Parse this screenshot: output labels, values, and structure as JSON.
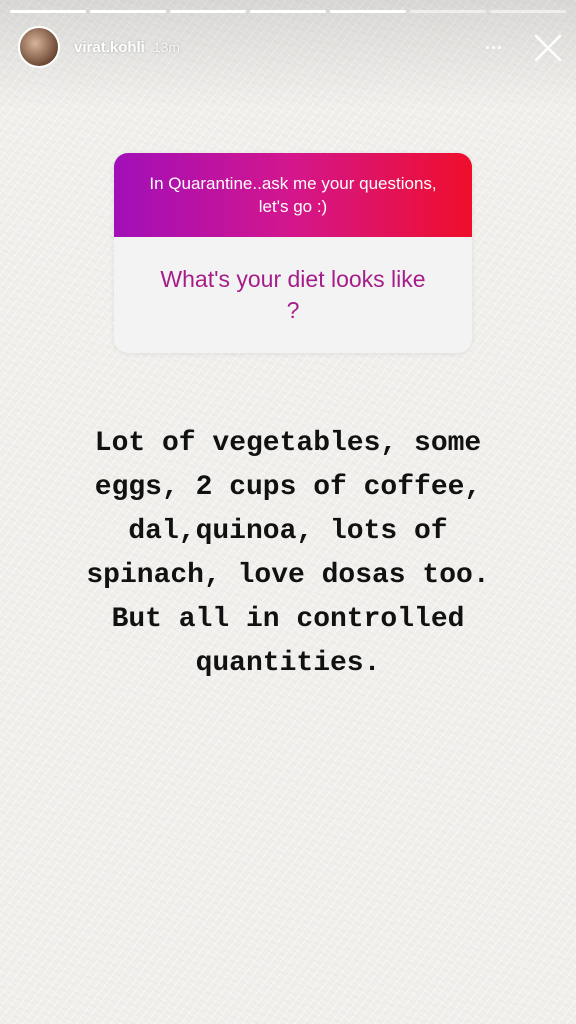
{
  "story": {
    "progress_segments": 7,
    "active_segments": 5,
    "username": "virat.kohli",
    "time_ago": "13m",
    "avatar_icon": "user-avatar",
    "more_icon": "more-horizontal-icon",
    "close_icon": "close-icon"
  },
  "question_sticker": {
    "prompt": "In Quarantine..ask me your questions, let's go :)",
    "question": "What's your diet looks like ?",
    "gradient_colors": [
      "#a10fb8",
      "#d4168c",
      "#ef0f2b"
    ],
    "question_color": "#a61d8a"
  },
  "answer": {
    "lines": [
      "Lot of vegetables, some",
      "eggs, 2 cups of coffee,",
      "dal,quinoa, lots of",
      "spinach, love dosas too.",
      "But all in controlled",
      "quantities."
    ]
  }
}
